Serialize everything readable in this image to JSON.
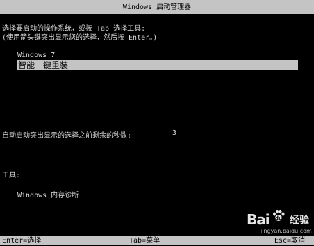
{
  "title": "Windows 启动管理器",
  "prompt_line_1": "选择要启动的操作系统，或按 Tab 选择工具:",
  "prompt_line_2": "(使用箭头键突出显示您的选择，然后按 Enter。)",
  "os_list": [
    {
      "label": "Windows 7",
      "selected": false
    },
    {
      "label": "智能一键重装",
      "selected": true
    }
  ],
  "countdown": {
    "label": "自动启动突出显示的选择之前剩余的秒数:",
    "value": "3"
  },
  "tools": {
    "heading": "工具:",
    "items": [
      {
        "label": "Windows 内存诊断"
      }
    ]
  },
  "footer": {
    "enter": "Enter=选择",
    "tab": "Tab=菜单",
    "esc": "Esc=取消"
  },
  "watermark": {
    "logo": "Bai",
    "logo_suffix": "经验",
    "url": "jingyan.baidu.com"
  },
  "colors": {
    "background": "#000000",
    "bar": "#c4c4c4",
    "text": "#d8d8d8"
  }
}
